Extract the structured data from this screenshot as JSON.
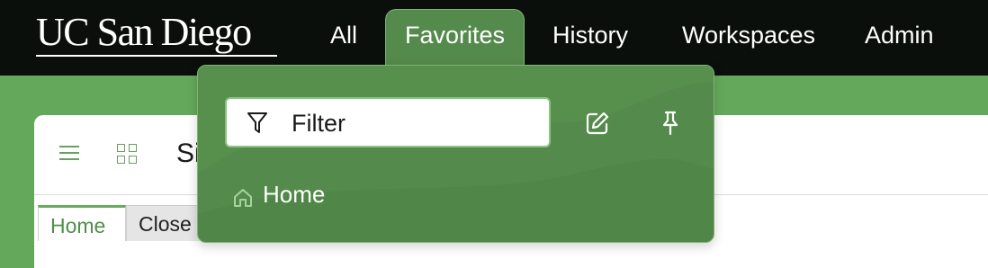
{
  "brand": {
    "logo_text": "UC San Diego"
  },
  "nav": {
    "items": [
      {
        "label": "All"
      },
      {
        "label": "Favorites"
      },
      {
        "label": "History"
      },
      {
        "label": "Workspaces"
      },
      {
        "label": "Admin"
      }
    ],
    "active": "Favorites"
  },
  "workspace": {
    "title_partial": "Si",
    "tabs": [
      {
        "label": "Home"
      },
      {
        "label": "Close"
      }
    ]
  },
  "favorites_menu": {
    "filter_placeholder": "Filter",
    "items": [
      {
        "label": "Home",
        "icon": "home-icon"
      }
    ],
    "actions": [
      "edit-icon",
      "pin-icon"
    ]
  },
  "colors": {
    "topbar": "#0b0f0b",
    "accent_green": "#64a95b",
    "dropdown_bg": "#548a4b",
    "filter_border": "#8bc481"
  }
}
